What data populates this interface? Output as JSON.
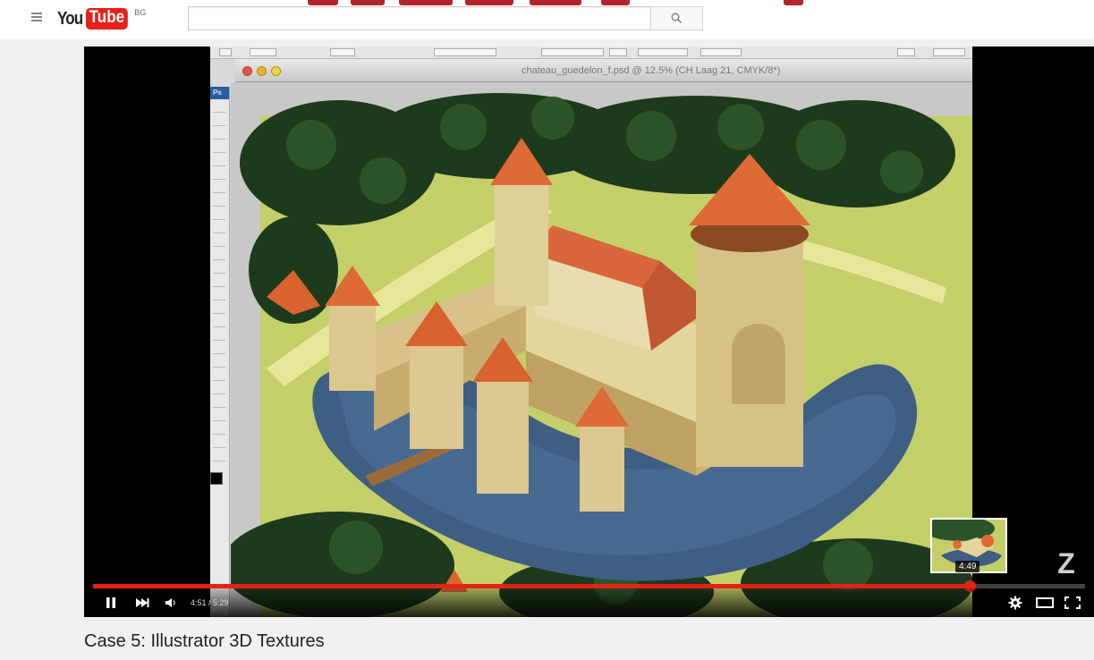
{
  "masthead": {
    "logo_you": "You",
    "logo_tube": "Tube",
    "region": "BG",
    "search_placeholder": "",
    "search_value": ""
  },
  "video": {
    "document_title": "chateau_guedelon_f.psd @ 12.5% (CH Laag 21, CMYK/8*)",
    "toolbox_label": "Ps",
    "current_time": "4:51",
    "duration": "5:29",
    "time_separator": " / ",
    "hover_time": "4:49",
    "watermark": "Z",
    "progress_fraction": 0.884,
    "hover_fraction": 0.879,
    "accent_color": "#e62117"
  },
  "title": "Case 5: Illustrator 3D Textures",
  "icons": [
    "menu-icon",
    "search-icon",
    "pause-icon",
    "next-icon",
    "volume-icon",
    "settings-icon",
    "theater-mode-icon",
    "fullscreen-icon"
  ]
}
